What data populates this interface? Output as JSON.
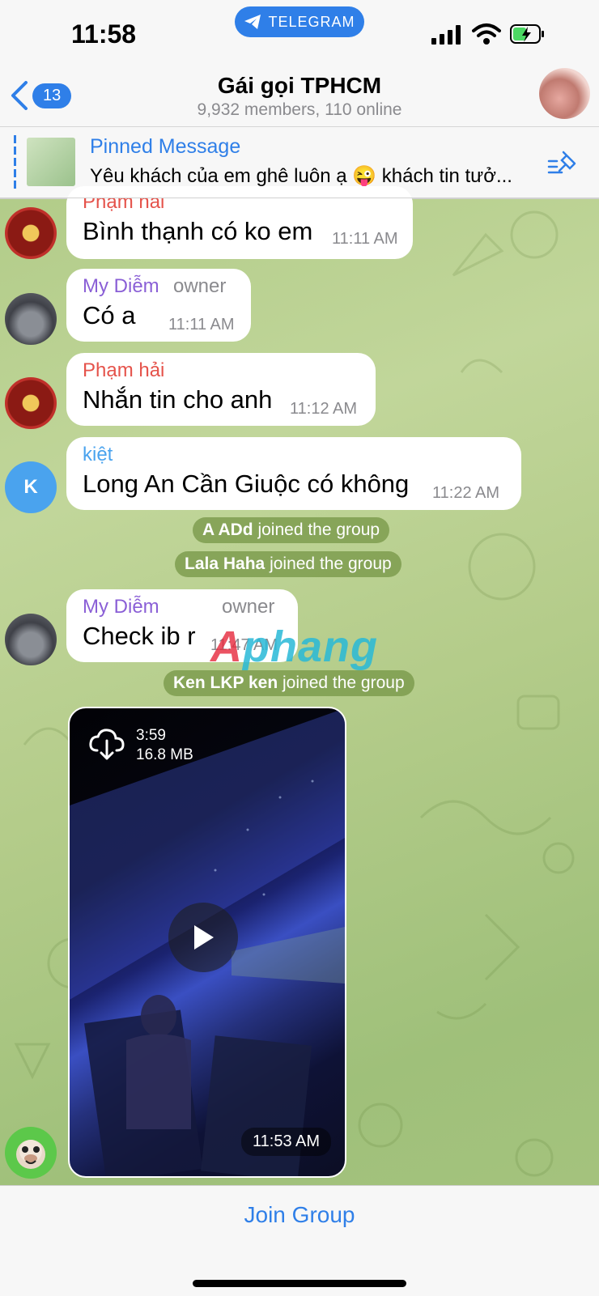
{
  "status": {
    "time": "11:58",
    "app_pill": "TELEGRAM"
  },
  "header": {
    "back_count": "13",
    "title": "Gái gọi TPHCM",
    "subtitle": "9,932 members, 110 online"
  },
  "pinned": {
    "title": "Pinned Message",
    "text": "Yêu khách của em ghê luôn ạ 😜 khách tin tưở..."
  },
  "messages": [
    {
      "sender": "Phạm hải",
      "text": "Bình thạnh có ko em",
      "time": "11:11 AM"
    },
    {
      "sender": "My Diễm",
      "role": "owner",
      "text": "Có a",
      "time": "11:11 AM"
    },
    {
      "sender": "Phạm hải",
      "text": "Nhắn tin cho anh",
      "time": "11:12 AM"
    },
    {
      "sender": "kiệt",
      "avatar_letter": "K",
      "text": "Long An Cần Giuộc có không",
      "time": "11:22 AM"
    },
    {
      "sender": "My Diễm",
      "role": "owner",
      "text": "Check ib r",
      "time": "11:47 AM"
    }
  ],
  "system": [
    {
      "name": "A ADd",
      "action": "joined the group"
    },
    {
      "name": "Lala Haha",
      "action": "joined the group"
    },
    {
      "name": "Ken LKP ken",
      "action": "joined the group"
    }
  ],
  "video": {
    "duration": "3:59",
    "size": "16.8 MB",
    "time": "11:53 AM"
  },
  "watermark": {
    "part1": "A",
    "part2": "phang"
  },
  "bottom": {
    "join_label": "Join Group"
  },
  "colors": {
    "accent": "#2f7fe8",
    "sender_red": "#e5534b",
    "sender_purple": "#8a5fd6",
    "sender_blue": "#4aa3ee"
  }
}
